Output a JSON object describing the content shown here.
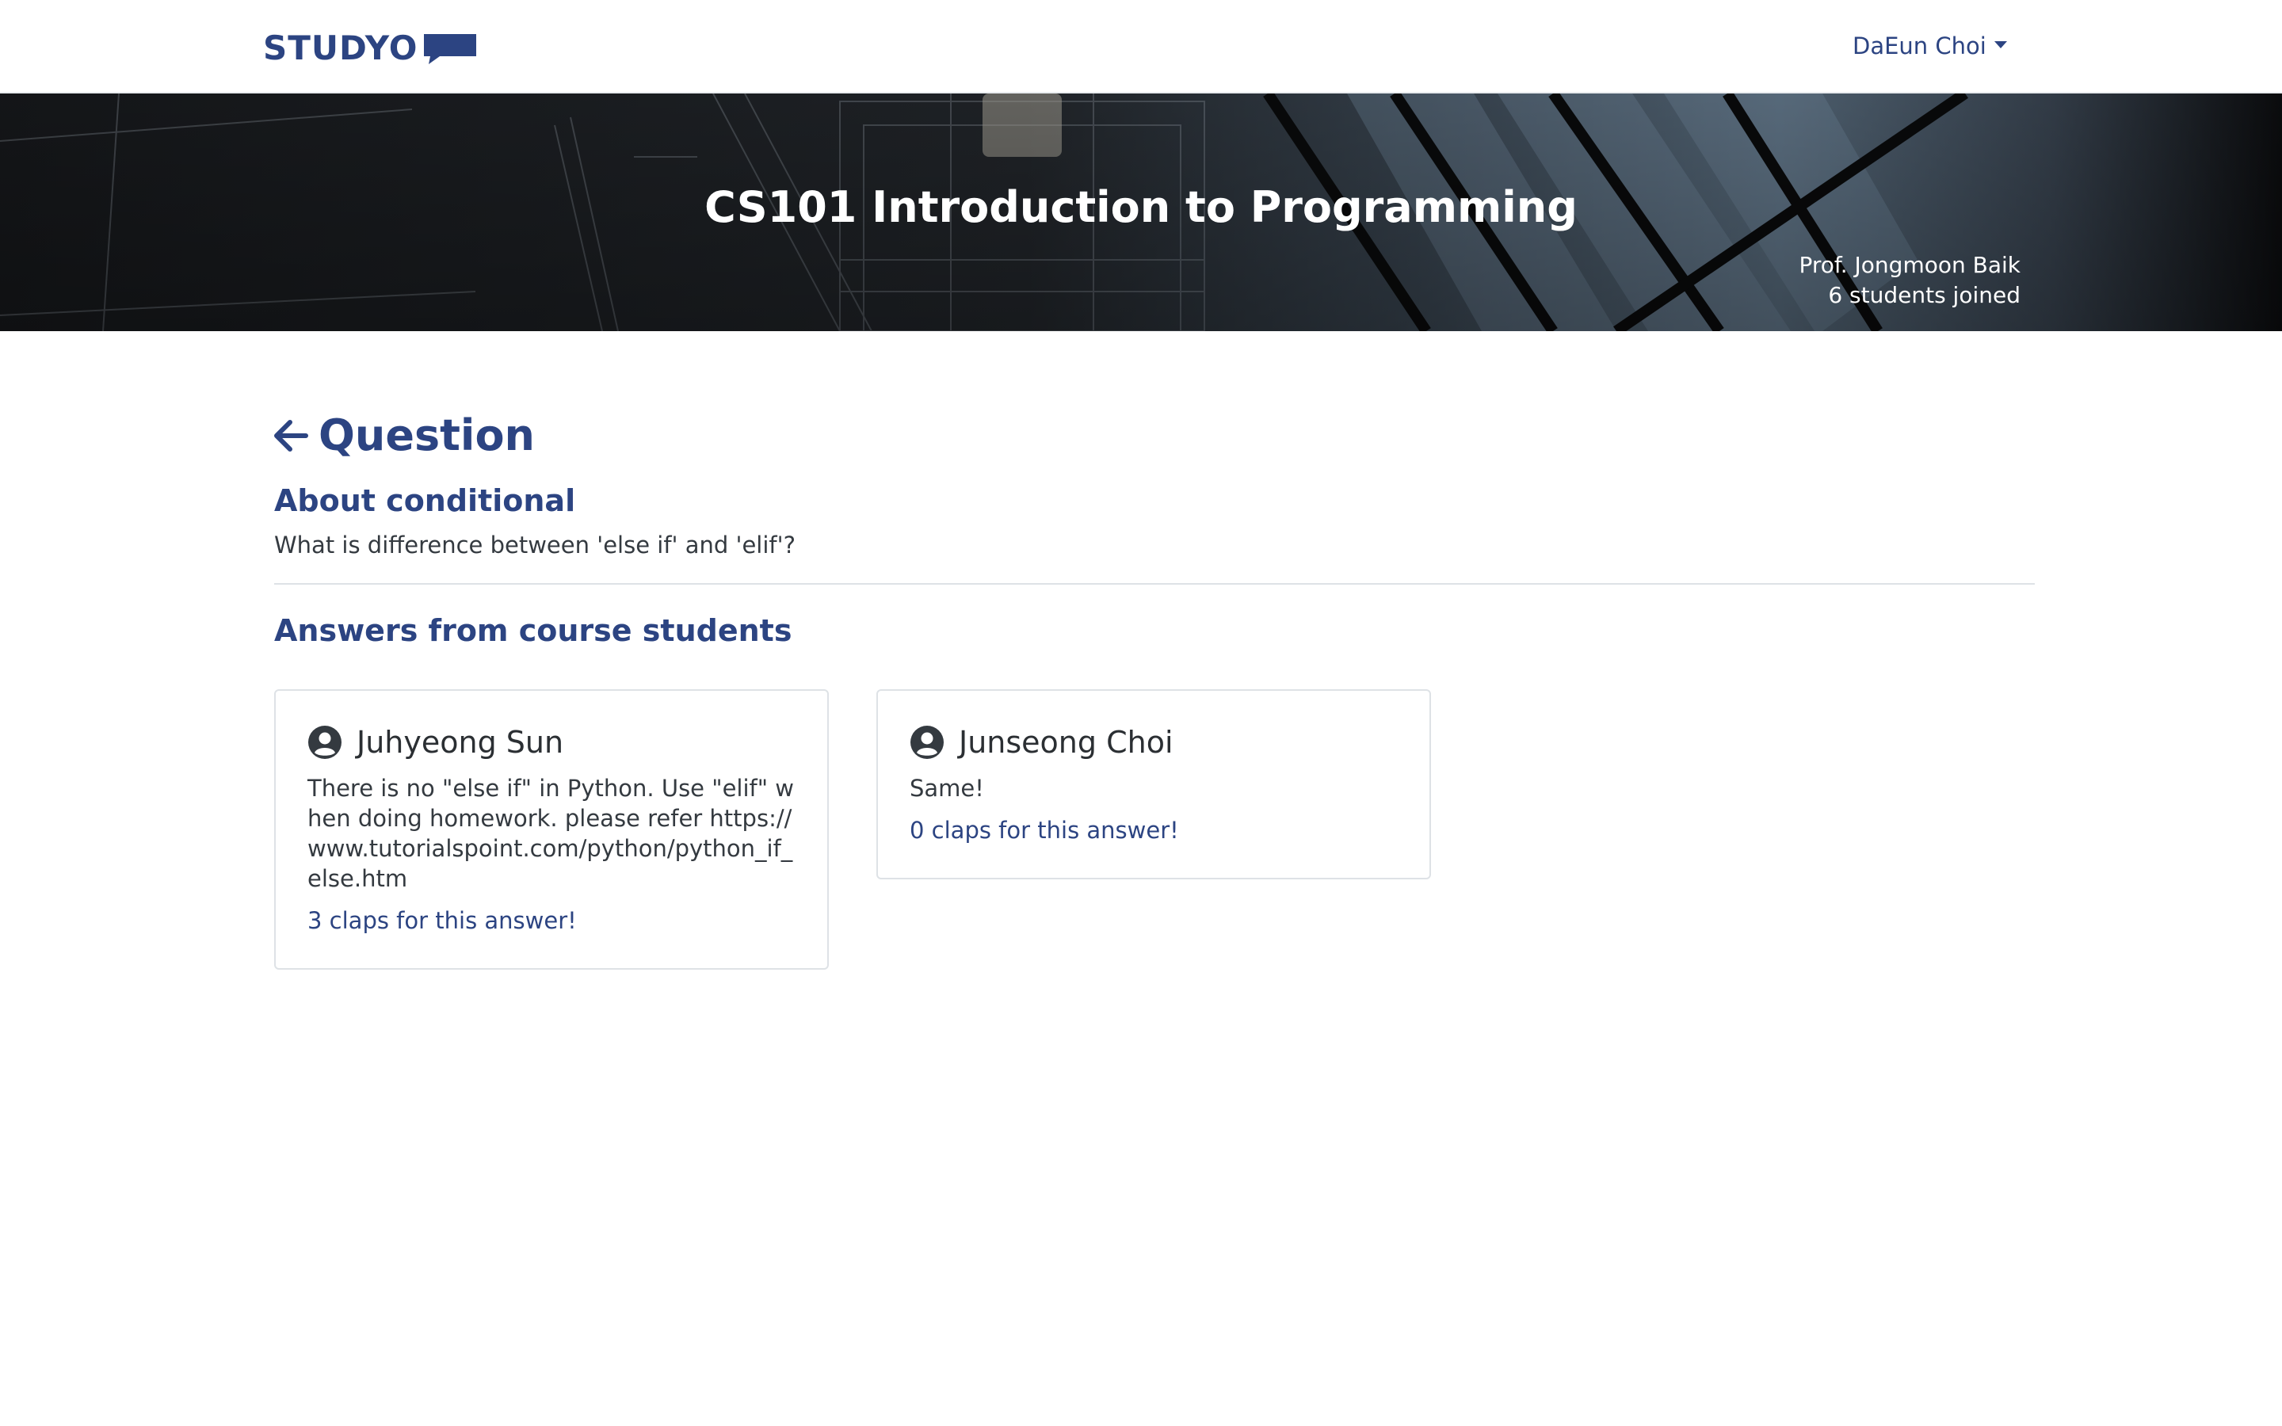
{
  "navbar": {
    "logo_text": "STUDYO",
    "user_name": "DaEun Choi"
  },
  "course": {
    "title": "CS101 Introduction to Programming",
    "professor": "Prof. Jongmoon Baik",
    "students": "6 students joined"
  },
  "question": {
    "page_title": "Question",
    "title": "About conditional",
    "body": "What is difference between 'else if' and 'elif'?"
  },
  "answers": {
    "heading": "Answers from course students",
    "items": [
      {
        "author": "Juhyeong Sun",
        "text": "There is no \"else if\" in Python. Use \"elif\" when doing homework. please refer https://www.tutorialspoint.com/python/python_if_else.htm",
        "claps": "3 claps for this answer!"
      },
      {
        "author": "Junseong Choi",
        "text": "Same!",
        "claps": "0 claps for this answer!"
      }
    ]
  },
  "icons": {
    "back": "arrow-left-icon",
    "avatar": "user-circle-icon",
    "dropdown": "caret-down-icon"
  },
  "colors": {
    "brand": "#2c4482",
    "hero_bg": "#1a1d21",
    "border": "#dee2e6"
  }
}
